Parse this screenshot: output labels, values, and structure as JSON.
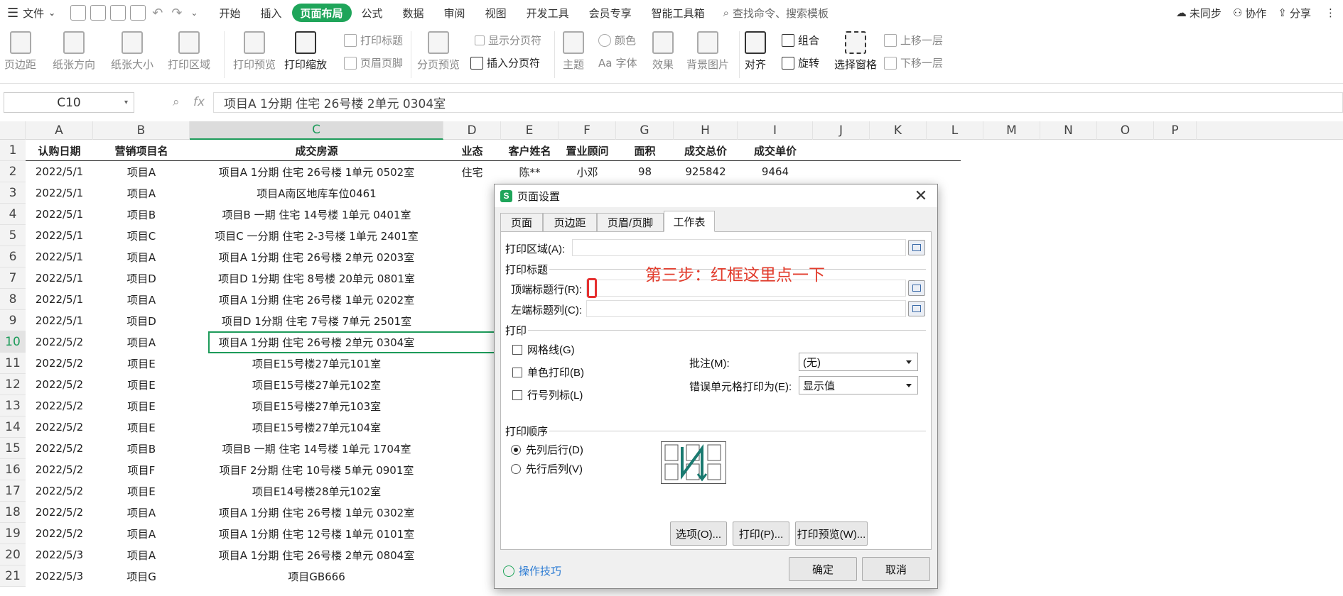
{
  "menubar": {
    "file": "文件",
    "tabs": [
      "开始",
      "插入",
      "页面布局",
      "公式",
      "数据",
      "审阅",
      "视图",
      "开发工具",
      "会员专享",
      "智能工具箱"
    ],
    "active_tab": "页面布局",
    "search": "查找命令、搜索模板",
    "right": [
      "未同步",
      "协作",
      "分享"
    ]
  },
  "ribbon": {
    "margins": "页边距",
    "orientation": "纸张方向",
    "size": "纸张大小",
    "print_area": "打印区域",
    "print_preview": "打印预览",
    "print_scale": "打印缩放",
    "print_titles": "打印标题",
    "header_footer": "页眉页脚",
    "page_break_preview": "分页预览",
    "show_page_breaks": "显示分页符",
    "insert_page_break": "插入分页符",
    "theme": "主题",
    "color": "颜色",
    "font": "字体",
    "effect": "效果",
    "background": "背景图片",
    "align": "对齐",
    "group": "组合",
    "rotate": "旋转",
    "selection_pane": "选择窗格",
    "bring_forward": "上移一层",
    "send_backward": "下移一层"
  },
  "formula_bar": {
    "name_box": "C10",
    "fx": "fx",
    "content": "项目A 1分期 住宅 26号楼 2单元 0304室"
  },
  "columns": [
    "A",
    "B",
    "C",
    "D",
    "E",
    "F",
    "G",
    "H",
    "I",
    "J",
    "K",
    "L",
    "M",
    "N",
    "O",
    "P"
  ],
  "row_numbers": [
    "1",
    "2",
    "3",
    "4",
    "5",
    "6",
    "7",
    "8",
    "9",
    "10",
    "11",
    "12",
    "13",
    "14",
    "15",
    "16",
    "17",
    "18",
    "19",
    "20",
    "21"
  ],
  "header_row": [
    "认购日期",
    "营销项目名",
    "成交房源",
    "业态",
    "客户姓名",
    "置业顾问",
    "面积",
    "成交总价",
    "成交单价"
  ],
  "rows": [
    [
      "2022/5/1",
      "项目A",
      "项目A 1分期 住宅 26号楼 1单元 0502室",
      "住宅",
      "陈**",
      "小邓",
      "98",
      "925842",
      "9464"
    ],
    [
      "2022/5/1",
      "项目A",
      "项目A南区地库车位0461"
    ],
    [
      "2022/5/1",
      "项目B",
      "项目B 一期 住宅 14号楼 1单元 0401室"
    ],
    [
      "2022/5/1",
      "项目C",
      "项目C 一分期 住宅 2-3号楼 1单元 2401室"
    ],
    [
      "2022/5/1",
      "项目A",
      "项目A 1分期 住宅 26号楼 2单元 0203室"
    ],
    [
      "2022/5/1",
      "项目D",
      "项目D 1分期 住宅 8号楼 20单元 0801室"
    ],
    [
      "2022/5/1",
      "项目A",
      "项目A 1分期 住宅 26号楼 1单元 0202室"
    ],
    [
      "2022/5/1",
      "项目D",
      "项目D 1分期 住宅 7号楼 7单元 2501室"
    ],
    [
      "2022/5/2",
      "项目A",
      "项目A 1分期 住宅 26号楼 2单元 0304室"
    ],
    [
      "2022/5/2",
      "项目E",
      "项目E15号楼27单元101室"
    ],
    [
      "2022/5/2",
      "项目E",
      "项目E15号楼27单元102室"
    ],
    [
      "2022/5/2",
      "项目E",
      "项目E15号楼27单元103室"
    ],
    [
      "2022/5/2",
      "项目E",
      "项目E15号楼27单元104室"
    ],
    [
      "2022/5/2",
      "项目B",
      "项目B 一期 住宅 14号楼 1单元 1704室"
    ],
    [
      "2022/5/2",
      "项目F",
      "项目F 2分期 住宅 10号楼 5单元 0901室"
    ],
    [
      "2022/5/2",
      "项目E",
      "项目E14号楼28单元102室"
    ],
    [
      "2022/5/2",
      "项目A",
      "项目A 1分期 住宅 26号楼 1单元 0302室"
    ],
    [
      "2022/5/2",
      "项目A",
      "项目A 1分期 住宅 12号楼 1单元 0101室"
    ],
    [
      "2022/5/3",
      "项目A",
      "项目A 1分期 住宅 26号楼 2单元 0804室"
    ],
    [
      "2022/5/3",
      "项目G",
      "项目GB666"
    ]
  ],
  "dialog": {
    "title": "页面设置",
    "tabs": [
      "页面",
      "页边距",
      "页眉/页脚",
      "工作表"
    ],
    "active_tab": "工作表",
    "print_area_label": "打印区域(A):",
    "print_titles_group": "打印标题",
    "top_rows_label": "顶端标题行(R):",
    "left_cols_label": "左端标题列(C):",
    "print_group": "打印",
    "gridlines": "网格线(G)",
    "mono": "单色打印(B)",
    "row_col_headers": "行号列标(L)",
    "comments_label": "批注(M):",
    "comments_value": "(无)",
    "errors_label": "错误单元格打印为(E):",
    "errors_value": "显示值",
    "order_group": "打印顺序",
    "down_then_over": "先列后行(D)",
    "over_then_down": "先行后列(V)",
    "options_btn": "选项(O)...",
    "print_btn": "打印(P)...",
    "preview_btn": "打印预览(W)...",
    "tips": "操作技巧",
    "ok": "确定",
    "cancel": "取消"
  },
  "annotation": "第三步：红框这里点一下"
}
